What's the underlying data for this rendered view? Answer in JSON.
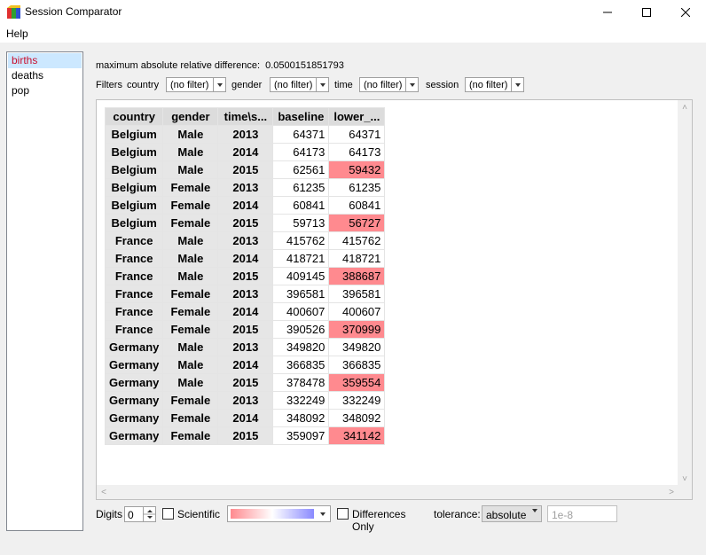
{
  "window": {
    "title": "Session Comparator"
  },
  "menu": {
    "help": "Help"
  },
  "sidebar": {
    "items": [
      "births",
      "deaths",
      "pop"
    ],
    "selected": "births"
  },
  "summary": {
    "label": "maximum absolute relative difference:",
    "value": "0.0500151851793"
  },
  "filters": {
    "label": "Filters",
    "items": [
      {
        "name": "country",
        "value": "(no filter)"
      },
      {
        "name": "gender",
        "value": "(no filter)"
      },
      {
        "name": "time",
        "value": "(no filter)"
      },
      {
        "name": "session",
        "value": "(no filter)"
      }
    ]
  },
  "table": {
    "headers": [
      "country",
      "gender",
      "time\\s...",
      "baseline",
      "lower_..."
    ],
    "rows": [
      [
        "Belgium",
        "Male",
        "2013",
        "64371",
        "64371",
        false
      ],
      [
        "Belgium",
        "Male",
        "2014",
        "64173",
        "64173",
        false
      ],
      [
        "Belgium",
        "Male",
        "2015",
        "62561",
        "59432",
        true
      ],
      [
        "Belgium",
        "Female",
        "2013",
        "61235",
        "61235",
        false
      ],
      [
        "Belgium",
        "Female",
        "2014",
        "60841",
        "60841",
        false
      ],
      [
        "Belgium",
        "Female",
        "2015",
        "59713",
        "56727",
        true
      ],
      [
        "France",
        "Male",
        "2013",
        "415762",
        "415762",
        false
      ],
      [
        "France",
        "Male",
        "2014",
        "418721",
        "418721",
        false
      ],
      [
        "France",
        "Male",
        "2015",
        "409145",
        "388687",
        true
      ],
      [
        "France",
        "Female",
        "2013",
        "396581",
        "396581",
        false
      ],
      [
        "France",
        "Female",
        "2014",
        "400607",
        "400607",
        false
      ],
      [
        "France",
        "Female",
        "2015",
        "390526",
        "370999",
        true
      ],
      [
        "Germany",
        "Male",
        "2013",
        "349820",
        "349820",
        false
      ],
      [
        "Germany",
        "Male",
        "2014",
        "366835",
        "366835",
        false
      ],
      [
        "Germany",
        "Male",
        "2015",
        "378478",
        "359554",
        true
      ],
      [
        "Germany",
        "Female",
        "2013",
        "332249",
        "332249",
        false
      ],
      [
        "Germany",
        "Female",
        "2014",
        "348092",
        "348092",
        false
      ],
      [
        "Germany",
        "Female",
        "2015",
        "359097",
        "341142",
        true
      ]
    ]
  },
  "bottom": {
    "digits_label": "Digits",
    "digits_value": "0",
    "scientific_label": "Scientific",
    "differences_only_label": "Differences Only",
    "tolerance_label": "tolerance:",
    "tolerance_mode": "absolute",
    "tolerance_placeholder": "1e-8"
  },
  "colors": {
    "diff_highlight": "#ff8a8f",
    "selected_item_text": "#c8102e",
    "selected_item_bg": "#cce8ff"
  }
}
